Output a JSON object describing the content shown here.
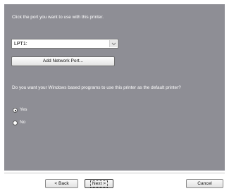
{
  "wizard": {
    "port_prompt": "Click the port you want to use with this printer.",
    "port_select": {
      "value": "LPT1:",
      "arrow_icon": "chevron-down-icon"
    },
    "add_network_port_label": "Add Network Port...",
    "default_prompt": "Do you want your Windows based programs to use this printer as the default printer?",
    "options": [
      {
        "label": "Yes",
        "selected": true
      },
      {
        "label": "No",
        "selected": false
      }
    ]
  },
  "footer": {
    "back_label": "< Back",
    "next_label": "Next >",
    "cancel_label": "Cancel"
  },
  "colors": {
    "panel_background": "#8e8e95",
    "text": "#ffffff"
  }
}
